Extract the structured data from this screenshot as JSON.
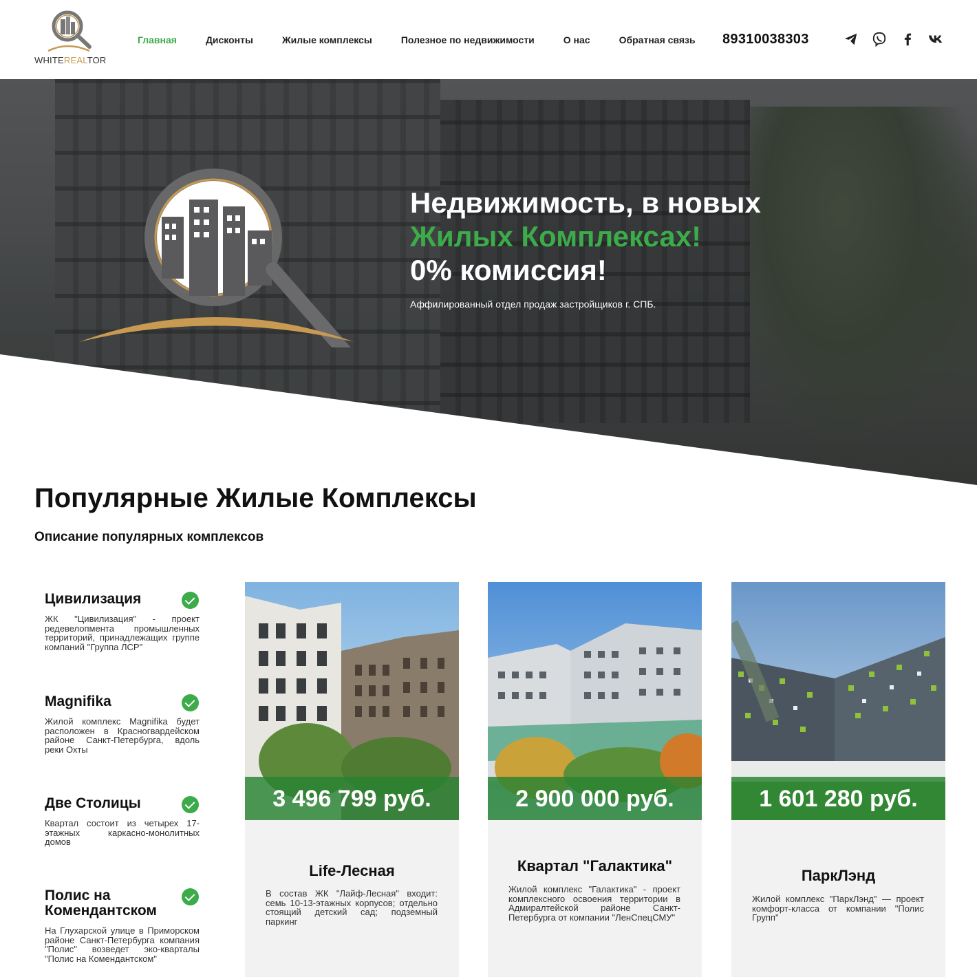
{
  "header": {
    "logo": {
      "text_a": "WHITE",
      "text_b": "REAL",
      "text_c": "TOR"
    },
    "nav": [
      {
        "label": "Главная",
        "active": true
      },
      {
        "label": "Дисконты",
        "active": false
      },
      {
        "label": "Жилые комплексы",
        "active": false
      },
      {
        "label": "Полезное по недвижимости",
        "active": false
      },
      {
        "label": "О нас",
        "active": false
      },
      {
        "label": "Обратная связь",
        "active": false
      }
    ],
    "phone": "89310038303",
    "socials": [
      "telegram-icon",
      "viber-icon",
      "facebook-icon",
      "vk-icon"
    ]
  },
  "hero": {
    "title_line1": "Недвижимость, в новых",
    "title_line2": "Жилых Комплексах!",
    "title_line3": "0% комиссия!",
    "subtitle": "Аффилированный отдел продаж застройщиков г. СПБ."
  },
  "section": {
    "title": "Популярные Жилые Комплексы",
    "subtitle": "Описание популярных комплексов"
  },
  "features": [
    {
      "name": "Цивилизация",
      "desc": "ЖК \"Цивилизация\" - проект редевелопмента промышленных территорий, принадлежащих группе компаний \"Группа ЛСР\""
    },
    {
      "name": "Magnifika",
      "desc": "Жилой комплекс Magnifika будет расположен в Красногвардейском районе Санкт-Петербурга, вдоль реки Охты"
    },
    {
      "name": "Две Столицы",
      "desc": "Квартал состоит из четырех 17-этажных каркасно-монолитных домов"
    },
    {
      "name": "Полис на Комендантском",
      "desc": "На Глухарской улице в Приморском районе Санкт-Петербурга компания \"Полис\" возведет эко-кварталы \"Полис на Комендантском\""
    }
  ],
  "cards": [
    {
      "price": "3 496 799 руб.",
      "name": "Life-Лесная",
      "desc": "В состав ЖК \"Лайф-Лесная\" входит: семь 10-13-этажных корпусов; отдельно стоящий детский сад; подземный паркинг"
    },
    {
      "price": "2 900 000 руб.",
      "name": "Квартал \"Галактика\"",
      "desc": "Жилой комплекс \"Галактика\" - проект комплексного освоения территории в Адмиралтейской районе Санкт-Петербурга от компании \"ЛенСпецСМУ\""
    },
    {
      "price": "1 601 280 руб.",
      "name": "ПаркЛэнд",
      "desc": "Жилой комплекс \"ПаркЛэнд\" — проект комфорт-класса от компании \"Полис Групп\""
    }
  ],
  "colors": {
    "accent": "#3cab4a",
    "gold": "#c89a52",
    "dark": "#111111"
  }
}
